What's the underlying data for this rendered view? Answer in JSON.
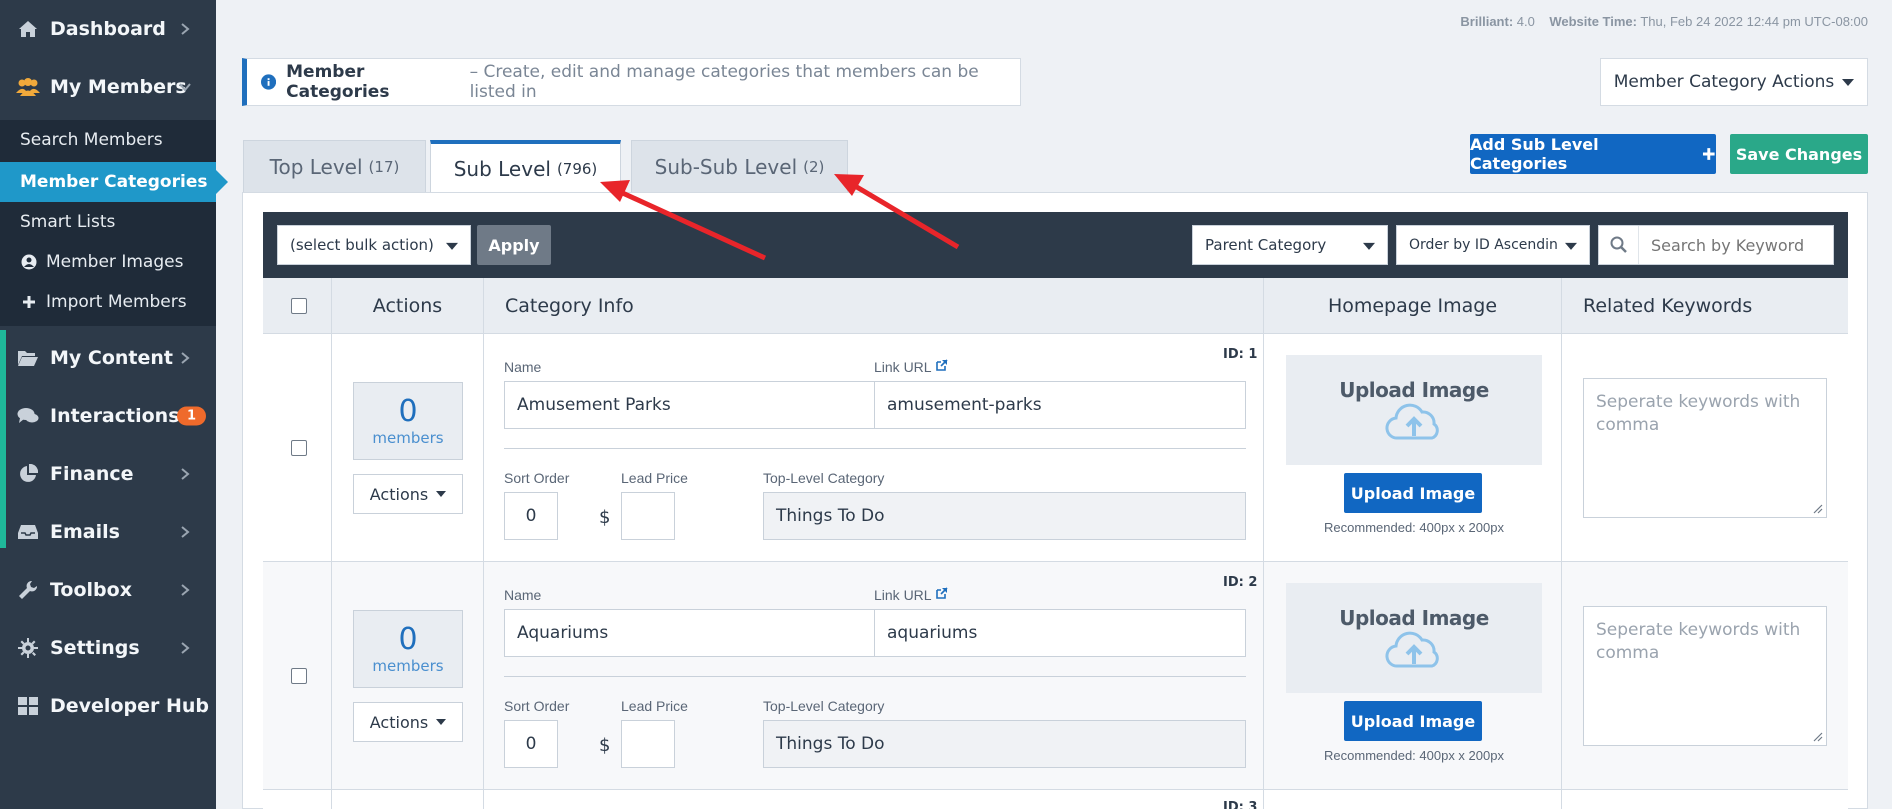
{
  "sidebar": {
    "items": [
      {
        "label": "Dashboard"
      },
      {
        "label": "My Members"
      },
      {
        "label": "My Content"
      },
      {
        "label": "Interactions",
        "badge": "1"
      },
      {
        "label": "Finance"
      },
      {
        "label": "Emails"
      },
      {
        "label": "Toolbox"
      },
      {
        "label": "Settings"
      },
      {
        "label": "Developer Hub"
      }
    ],
    "sub_items": [
      {
        "label": "Search Members"
      },
      {
        "label": "Member Categories"
      },
      {
        "label": "Smart Lists"
      },
      {
        "label": "Member Images"
      },
      {
        "label": "Import Members"
      }
    ]
  },
  "topmeta": {
    "brand_label": "Brilliant:",
    "brand_version": "4.0",
    "time_label": "Website Time:",
    "time_value": "Thu, Feb 24 2022 12:44 pm UTC-08:00"
  },
  "banner": {
    "title": "Member Categories",
    "description": "– Create, edit and manage categories that members can be listed in"
  },
  "header_actions": {
    "category_actions": "Member Category Actions",
    "add_button": "Add Sub Level Categories",
    "save_button": "Save Changes"
  },
  "tabs": [
    {
      "label": "Top Level",
      "count": "(17)"
    },
    {
      "label": "Sub Level",
      "count": "(796)"
    },
    {
      "label": "Sub-Sub Level",
      "count": "(2)"
    }
  ],
  "toolbar": {
    "bulk_action": "(select bulk action)",
    "apply": "Apply",
    "parent_category": "Parent Category",
    "order_by": "Order by ID Ascendin",
    "search_placeholder": "Search by Keyword"
  },
  "table": {
    "headers": {
      "actions": "Actions",
      "category_info": "Category Info",
      "homepage_image": "Homepage Image",
      "related_keywords": "Related Keywords"
    },
    "labels": {
      "name": "Name",
      "link_url": "Link URL",
      "sort_order": "Sort Order",
      "lead_price": "Lead Price",
      "top_level_category": "Top-Level Category",
      "members": "members",
      "actions": "Actions",
      "upload_image_title": "Upload Image",
      "upload_image_button": "Upload Image",
      "recommended": "Recommended: 400px x 200px",
      "keywords_placeholder": "Seperate keywords with comma",
      "dollar": "$"
    },
    "rows": [
      {
        "id": "ID: 1",
        "members": "0",
        "name": "Amusement Parks",
        "link_url": "amusement-parks",
        "sort_order": "0",
        "lead_price": "",
        "top_level": "Things To Do"
      },
      {
        "id": "ID: 2",
        "members": "0",
        "name": "Aquariums",
        "link_url": "aquariums",
        "sort_order": "0",
        "lead_price": "",
        "top_level": "Things To Do"
      }
    ],
    "next_row_id": "ID: 3"
  },
  "colors": {
    "sidebar_bg": "#2d3a49",
    "active_blue": "#1f98c9",
    "primary_blue": "#1167c2",
    "save_green": "#2aa889",
    "annotation_red": "#e8252a"
  }
}
